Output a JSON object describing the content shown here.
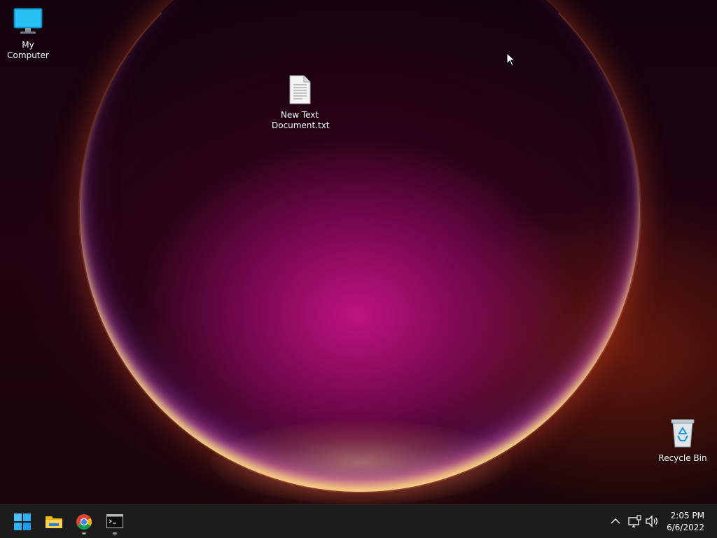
{
  "desktop": {
    "icons": [
      {
        "label": "My Computer",
        "icon": "monitor-icon"
      },
      {
        "label_line1": "New Text",
        "label_line2": "Document.txt",
        "icon": "text-file-icon"
      },
      {
        "label": "Recycle Bin",
        "icon": "recycle-bin-icon"
      }
    ],
    "wallpaper_colors": {
      "primary": "#c4107e",
      "rim": "#ffd23a",
      "background": "#16040c"
    }
  },
  "taskbar": {
    "background": "#1c1c1c",
    "pinned": [
      {
        "name": "Start",
        "icon": "windows-start-icon",
        "running": false
      },
      {
        "name": "File Explorer",
        "icon": "folder-icon",
        "running": false
      },
      {
        "name": "Google Chrome",
        "icon": "chrome-icon",
        "running": true
      },
      {
        "name": "Command Prompt",
        "icon": "terminal-icon",
        "running": true
      }
    ],
    "tray": {
      "icons": [
        "chevron-up-icon",
        "network-icon",
        "volume-icon"
      ],
      "time": "2:05 PM",
      "date": "6/6/2022"
    }
  }
}
